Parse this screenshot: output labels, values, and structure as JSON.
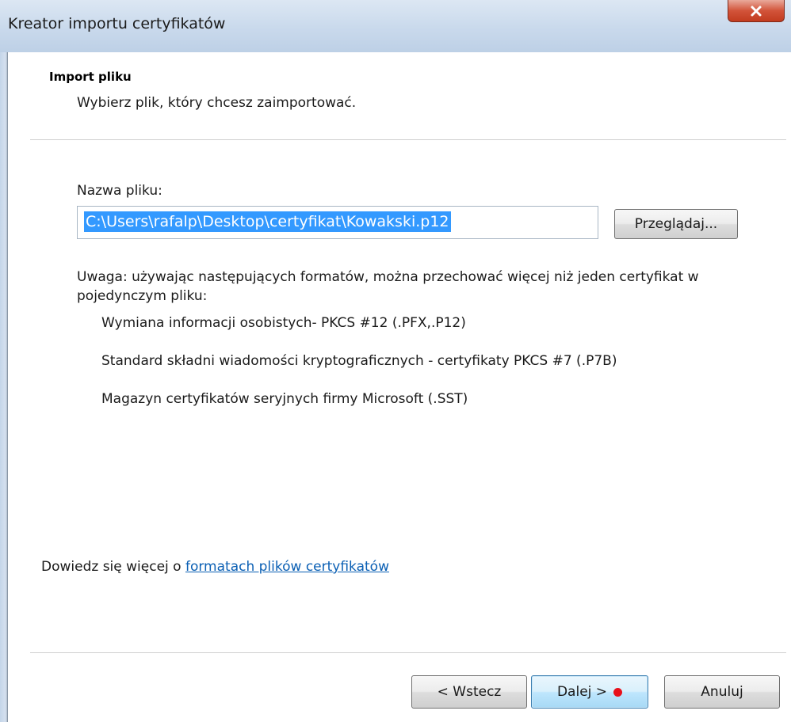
{
  "window": {
    "title": "Kreator importu certyfikatów"
  },
  "header": {
    "title": "Import pliku",
    "subtitle": "Wybierz plik, który chcesz zaimportować."
  },
  "file_field": {
    "label": "Nazwa pliku:",
    "value": "C:\\Users\\rafalp\\Desktop\\certyfikat\\Kowakski.p12"
  },
  "browse_button": {
    "label": "Przeglądaj..."
  },
  "note": {
    "text": "Uwaga: używając następujących formatów, można przechować więcej niż jeden certyfikat w pojedynczym pliku:",
    "formats": [
      "Wymiana informacji osobistych- PKCS #12 (.PFX,.P12)",
      "Standard składni wiadomości kryptograficznych - certyfikaty PKCS #7 (.P7B)",
      "Magazyn certyfikatów seryjnych firmy Microsoft (.SST)"
    ]
  },
  "learn_more": {
    "prefix": "Dowiedz się więcej o ",
    "link": "formatach plików certyfikatów"
  },
  "buttons": {
    "back": "< Wstecz",
    "next": "Dalej >",
    "cancel": "Anuluj"
  },
  "colors": {
    "selection": "#3399ff",
    "link": "#0a5fb4",
    "record_dot": "#e8101a"
  },
  "icons": {
    "close": "close-icon"
  }
}
